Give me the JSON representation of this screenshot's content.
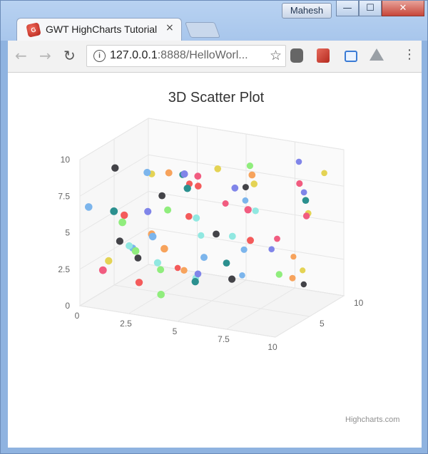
{
  "window": {
    "user": "Mahesh",
    "controls": {
      "minimize": "—",
      "maximize": "☐",
      "close": "✕"
    }
  },
  "tab": {
    "title": "GWT HighCharts Tutorial",
    "close": "×",
    "favicon": "G"
  },
  "toolbar": {
    "back": "←",
    "forward": "→",
    "reload": "↻",
    "url_host": "127.0.0.1",
    "url_rest": ":8888/HelloWorl...",
    "star": "☆",
    "menu": "⋮"
  },
  "icons": [
    "back-icon",
    "forward-icon",
    "reload-icon",
    "info-icon",
    "star-icon",
    "extension-icon",
    "pdf-icon",
    "folder-icon",
    "drive-icon",
    "menu-icon"
  ],
  "chart_data": {
    "type": "scatter",
    "title": "3D Scatter Plot",
    "credits": "Highcharts.com",
    "x_ticks": [
      "0",
      "2.5",
      "5",
      "7.5",
      "10"
    ],
    "y_ticks": [
      "0",
      "2.5",
      "5",
      "7.5",
      "10"
    ],
    "z_ticks": [
      "5",
      "10"
    ],
    "x_range": [
      0,
      10
    ],
    "y_range": [
      0,
      10
    ],
    "z_range": [
      0,
      10
    ],
    "colors": [
      "#7cb5ec",
      "#434348",
      "#90ed7d",
      "#f7a35c",
      "#8085e9",
      "#f15c80",
      "#e4d354",
      "#2b908f",
      "#f45b5b",
      "#91e8e1"
    ],
    "points": [
      [
        0.1,
        6.5,
        1
      ],
      [
        1.1,
        9.1,
        2
      ],
      [
        2,
        6,
        0.5
      ],
      [
        3.5,
        9,
        3
      ],
      [
        2.6,
        6.3,
        2.5
      ],
      [
        0.9,
        2.4,
        0.8
      ],
      [
        0.7,
        2.6,
        2.2
      ],
      [
        1.8,
        3.3,
        3
      ],
      [
        2.2,
        0.8,
        8
      ],
      [
        4,
        1.2,
        5.5
      ],
      [
        5.5,
        1,
        8
      ],
      [
        8.3,
        0.7,
        9
      ],
      [
        3.8,
        1.3,
        1
      ],
      [
        7.6,
        2.3,
        9.5
      ],
      [
        6.9,
        3,
        8.3
      ],
      [
        7.5,
        4.1,
        7.4
      ],
      [
        8.1,
        1.5,
        9.4
      ],
      [
        6.1,
        3.1,
        4
      ],
      [
        4,
        5.7,
        4.5
      ],
      [
        4.2,
        4.1,
        5.7
      ],
      [
        3.2,
        5,
        1.5
      ],
      [
        2.8,
        7,
        4
      ],
      [
        3.3,
        6.3,
        3.4
      ],
      [
        3.9,
        4.4,
        1.2
      ],
      [
        4.4,
        9.2,
        2.7
      ],
      [
        4.7,
        8.8,
        3.8
      ],
      [
        5.3,
        9.1,
        5
      ],
      [
        4.8,
        8.5,
        2
      ],
      [
        4.3,
        7.7,
        5
      ],
      [
        6.4,
        5,
        4
      ],
      [
        5.8,
        6.3,
        7.6
      ],
      [
        5.5,
        4.9,
        4.2
      ],
      [
        6.6,
        9.3,
        6
      ],
      [
        7.3,
        9.3,
        4.3
      ],
      [
        8.4,
        9.4,
        8
      ],
      [
        9.2,
        8.7,
        5.8
      ],
      [
        9.7,
        8.9,
        8
      ],
      [
        9.8,
        7.9,
        5
      ],
      [
        7.6,
        5.2,
        3.2
      ],
      [
        7.2,
        6.6,
        5.1
      ],
      [
        6.4,
        3.6,
        5.7
      ],
      [
        6.9,
        2.6,
        2.5
      ],
      [
        8.3,
        2.4,
        5.4
      ],
      [
        8.6,
        1.9,
        6.5
      ],
      [
        8.8,
        7.5,
        7.6
      ],
      [
        9.7,
        6.7,
        5.4
      ],
      [
        9.3,
        6.4,
        6.8
      ],
      [
        5.2,
        2.2,
        2
      ],
      [
        2.4,
        1.6,
        1.8
      ],
      [
        3.1,
        2.9,
        2.5
      ],
      [
        1.3,
        3.1,
        4
      ],
      [
        1.5,
        2.4,
        4.2
      ],
      [
        2.9,
        2.1,
        3.5
      ],
      [
        3.4,
        1.6,
        5.5
      ],
      [
        4.5,
        1.9,
        4.4
      ],
      [
        5.1,
        6.2,
        6.7
      ],
      [
        2.1,
        8.2,
        4.5
      ],
      [
        3.4,
        8.2,
        5.3
      ],
      [
        3.5,
        7.4,
        6
      ],
      [
        4.8,
        6.1,
        3.3
      ],
      [
        5.3,
        3.6,
        3
      ],
      [
        6.1,
        7.5,
        6.8
      ],
      [
        2.5,
        4,
        1
      ],
      [
        2.9,
        4.9,
        2.2
      ],
      [
        6.6,
        8.4,
        3.8
      ],
      [
        7.9,
        7.7,
        2
      ],
      [
        7.3,
        8.6,
        4.6
      ],
      [
        1.6,
        6.7,
        0.4
      ],
      [
        1.5,
        5.9,
        2.2
      ],
      [
        1.4,
        3.5,
        3.2
      ],
      [
        2.6,
        9,
        2.4
      ],
      [
        1.2,
        4,
        2.4
      ]
    ]
  }
}
